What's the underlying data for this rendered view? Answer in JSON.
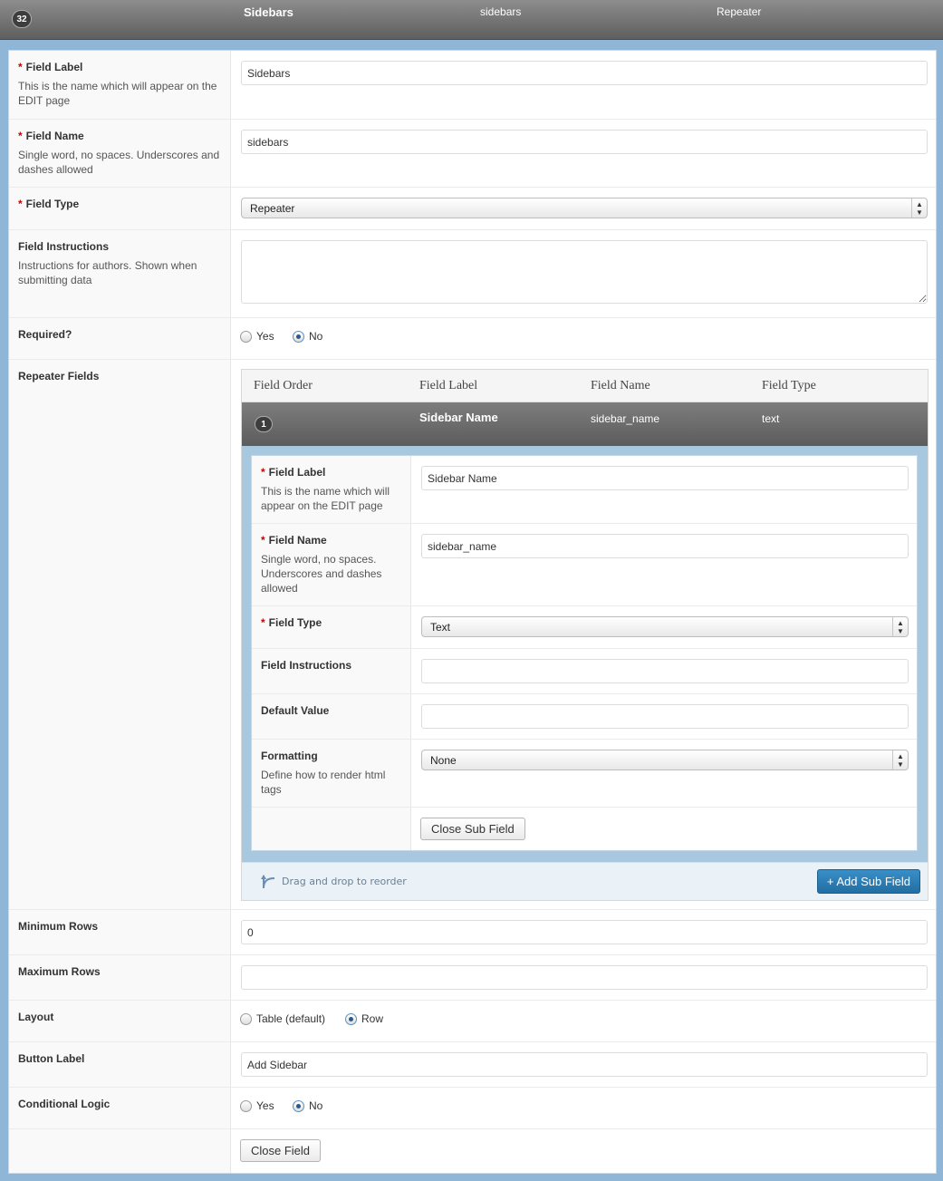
{
  "header": {
    "order": "32",
    "label": "Sidebars",
    "name": "sidebars",
    "type": "Repeater"
  },
  "field_label": {
    "title": "Field Label",
    "desc": "This is the name which will appear on the EDIT page",
    "value": "Sidebars"
  },
  "field_name": {
    "title": "Field Name",
    "desc": "Single word, no spaces. Underscores and dashes allowed",
    "value": "sidebars"
  },
  "field_type": {
    "title": "Field Type",
    "value": "Repeater"
  },
  "field_instructions": {
    "title": "Field Instructions",
    "desc": "Instructions for authors. Shown when submitting data",
    "value": ""
  },
  "required": {
    "title": "Required?",
    "yes": "Yes",
    "no": "No",
    "selected": "No"
  },
  "repeater": {
    "title": "Repeater Fields",
    "columns": [
      "Field Order",
      "Field Label",
      "Field Name",
      "Field Type"
    ],
    "sub_field": {
      "order": "1",
      "label": "Sidebar Name",
      "name": "sidebar_name",
      "type": "text",
      "field_label": {
        "title": "Field Label",
        "desc": "This is the name which will appear on the EDIT page",
        "value": "Sidebar Name"
      },
      "field_name": {
        "title": "Field Name",
        "desc": "Single word, no spaces. Underscores and dashes allowed",
        "value": "sidebar_name"
      },
      "field_type": {
        "title": "Field Type",
        "value": "Text"
      },
      "field_instructions": {
        "title": "Field Instructions",
        "value": ""
      },
      "default_value": {
        "title": "Default Value",
        "value": ""
      },
      "formatting": {
        "title": "Formatting",
        "desc": "Define how to render html tags",
        "value": "None"
      },
      "close_label": "Close Sub Field"
    },
    "drag_hint": "Drag and drop to reorder",
    "add_label": "+ Add Sub Field"
  },
  "min_rows": {
    "title": "Minimum Rows",
    "value": "0"
  },
  "max_rows": {
    "title": "Maximum Rows",
    "value": ""
  },
  "layout": {
    "title": "Layout",
    "opt1": "Table (default)",
    "opt2": "Row",
    "selected": "Row"
  },
  "button_label": {
    "title": "Button Label",
    "value": "Add Sidebar"
  },
  "conditional_logic": {
    "title": "Conditional Logic",
    "yes": "Yes",
    "no": "No",
    "selected": "No"
  },
  "close_field_label": "Close Field",
  "colors": {
    "accent": "#2a7ab5",
    "required": "#cc0000",
    "frame": "#8fb6d6"
  }
}
